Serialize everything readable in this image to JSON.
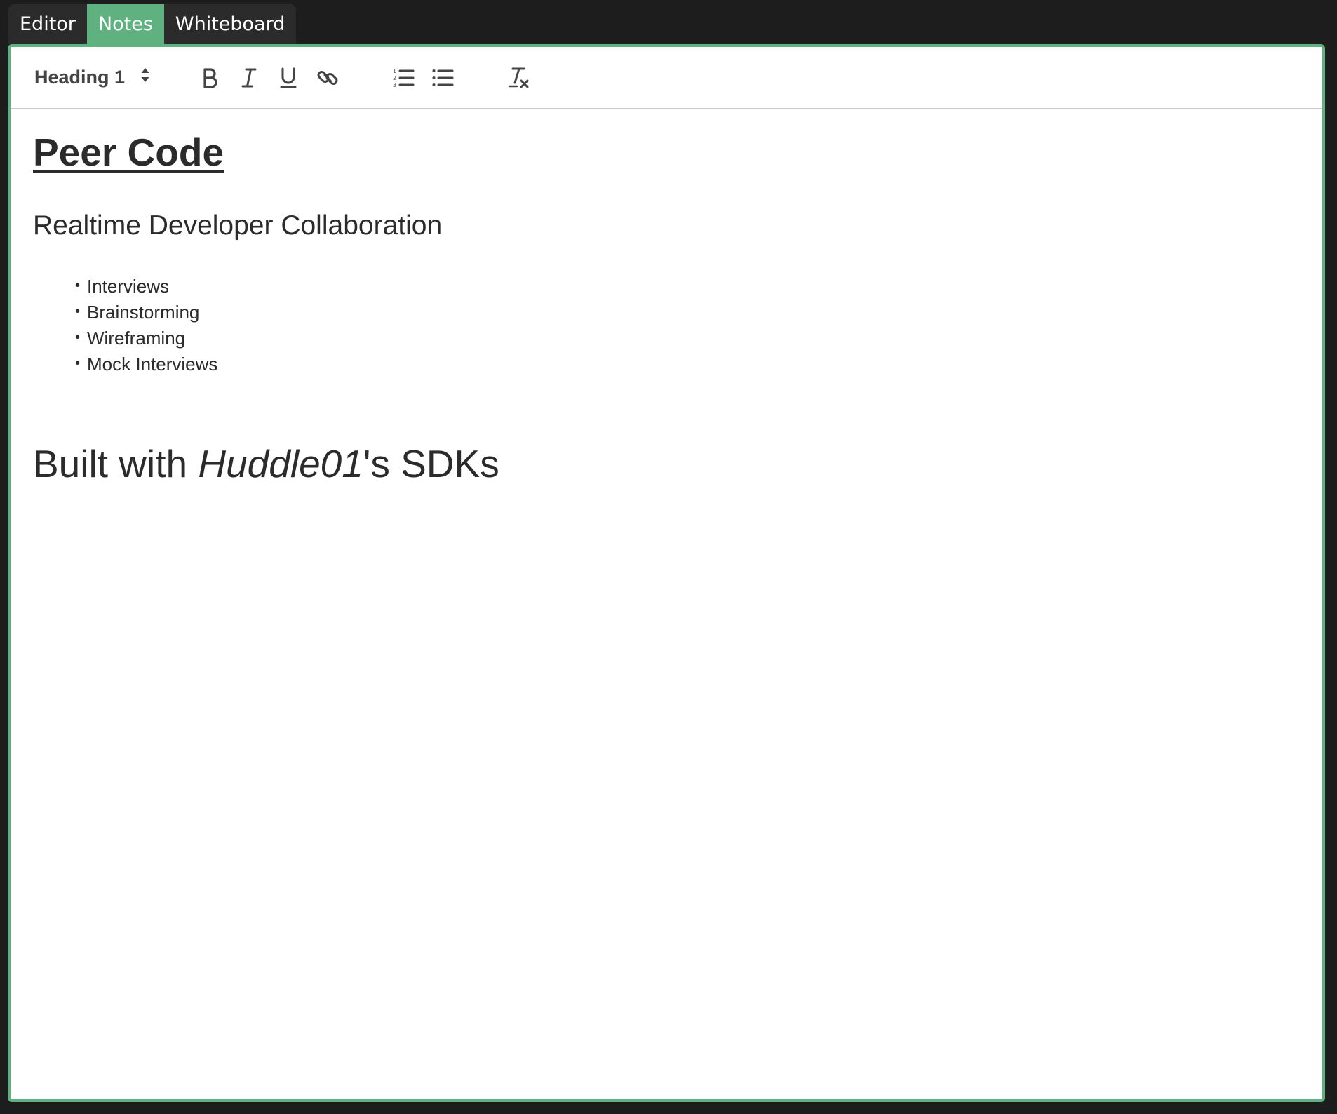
{
  "tabs": [
    {
      "label": "Editor",
      "active": false
    },
    {
      "label": "Notes",
      "active": true
    },
    {
      "label": "Whiteboard",
      "active": false
    }
  ],
  "toolbar": {
    "header_select": {
      "value": "Heading 1"
    },
    "icons": {
      "bold": "bold-icon",
      "italic": "italic-icon",
      "underline": "underline-icon",
      "link": "link-icon",
      "ordered_list": "ordered-list-icon",
      "bullet_list": "bullet-list-icon",
      "clear_format": "clear-format-icon"
    }
  },
  "document": {
    "title": "Peer Code",
    "subtitle": "Realtime Developer Collaboration",
    "bullets": [
      "Interviews",
      "Brainstorming",
      "Wireframing",
      "Mock Interviews"
    ],
    "built_with": {
      "prefix": "Built with ",
      "emphasis": "Huddle01",
      "suffix": "'s SDKs"
    }
  },
  "colors": {
    "accent": "#5fb17f",
    "background": "#1d1d1d",
    "text": "#2b2b2b"
  }
}
